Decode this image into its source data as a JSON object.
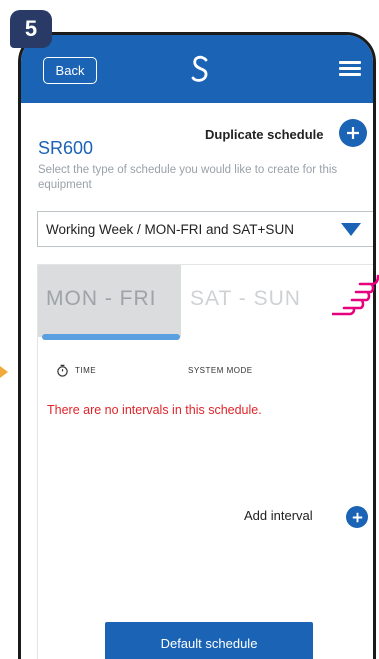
{
  "step_number": "5",
  "header": {
    "back_label": "Back",
    "logo_icon": "salus-logo-icon",
    "menu_icon": "hamburger-menu-icon"
  },
  "schedule": {
    "title": "SR600",
    "duplicate_label": "Duplicate schedule",
    "subtitle": "Select the type of schedule you would like to create for this equipment",
    "select_value": "Working Week / MON-FRI and SAT+SUN"
  },
  "tabs": [
    {
      "label": "MON - FRI",
      "active": true
    },
    {
      "label": "SAT - SUN",
      "active": false
    }
  ],
  "table": {
    "col_time": "TIME",
    "col_mode": "SYSTEM MODE",
    "empty_message": "There are no intervals in this schedule."
  },
  "add_interval_label": "Add interval",
  "default_button_label": "Default schedule",
  "colors": {
    "primary": "#1b63b5",
    "error": "#e0242a",
    "highlight": "#e6007e",
    "badge": "#2a3a66"
  }
}
